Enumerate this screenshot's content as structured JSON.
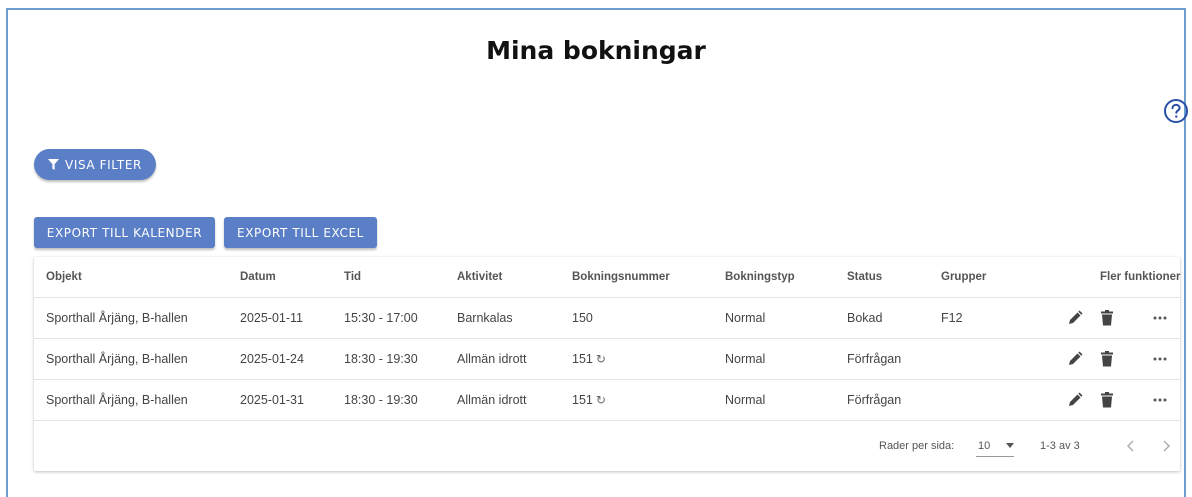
{
  "page": {
    "title": "Mina bokningar"
  },
  "icons": {
    "help": "help-circle-icon",
    "filter": "filter-icon",
    "edit": "pencil-icon",
    "delete": "trash-icon",
    "more": "more-horizontal-icon",
    "recurring": "refresh-icon",
    "dropdown": "caret-down-icon",
    "prev": "chevron-left-icon",
    "next": "chevron-right-icon"
  },
  "colors": {
    "primary": "#5b7fc7",
    "frame": "#6b9fd0"
  },
  "buttons": {
    "filter": "VISA FILTER",
    "export_calendar": "EXPORT TILL KALENDER",
    "export_excel": "EXPORT TILL EXCEL"
  },
  "table": {
    "headers": {
      "objekt": "Objekt",
      "datum": "Datum",
      "tid": "Tid",
      "aktivitet": "Aktivitet",
      "bokningsnummer": "Bokningsnummer",
      "bokningstyp": "Bokningstyp",
      "status": "Status",
      "grupper": "Grupper",
      "fler": "Fler funktioner"
    },
    "rows": [
      {
        "objekt": "Sporthall Årjäng, B-hallen",
        "datum": "2025-01-11",
        "tid": "15:30 - 17:00",
        "aktivitet": "Barnkalas",
        "bokningsnummer": "150",
        "bokningstyp": "Normal",
        "status": "Bokad",
        "grupper": "F12"
      },
      {
        "objekt": "Sporthall Årjäng, B-hallen",
        "datum": "2025-01-24",
        "tid": "18:30 - 19:30",
        "aktivitet": "Allmän idrott",
        "bokningsnummer": "151",
        "bokningstyp": "Normal",
        "status": "Förfrågan",
        "grupper": ""
      },
      {
        "objekt": "Sporthall Årjäng, B-hallen",
        "datum": "2025-01-31",
        "tid": "18:30 - 19:30",
        "aktivitet": "Allmän idrott",
        "bokningsnummer": "151",
        "bokningstyp": "Normal",
        "status": "Förfrågan",
        "grupper": ""
      }
    ]
  },
  "pagination": {
    "rows_per_page_label": "Rader per sida:",
    "rows_per_page_value": "10",
    "range": "1-3 av 3"
  }
}
